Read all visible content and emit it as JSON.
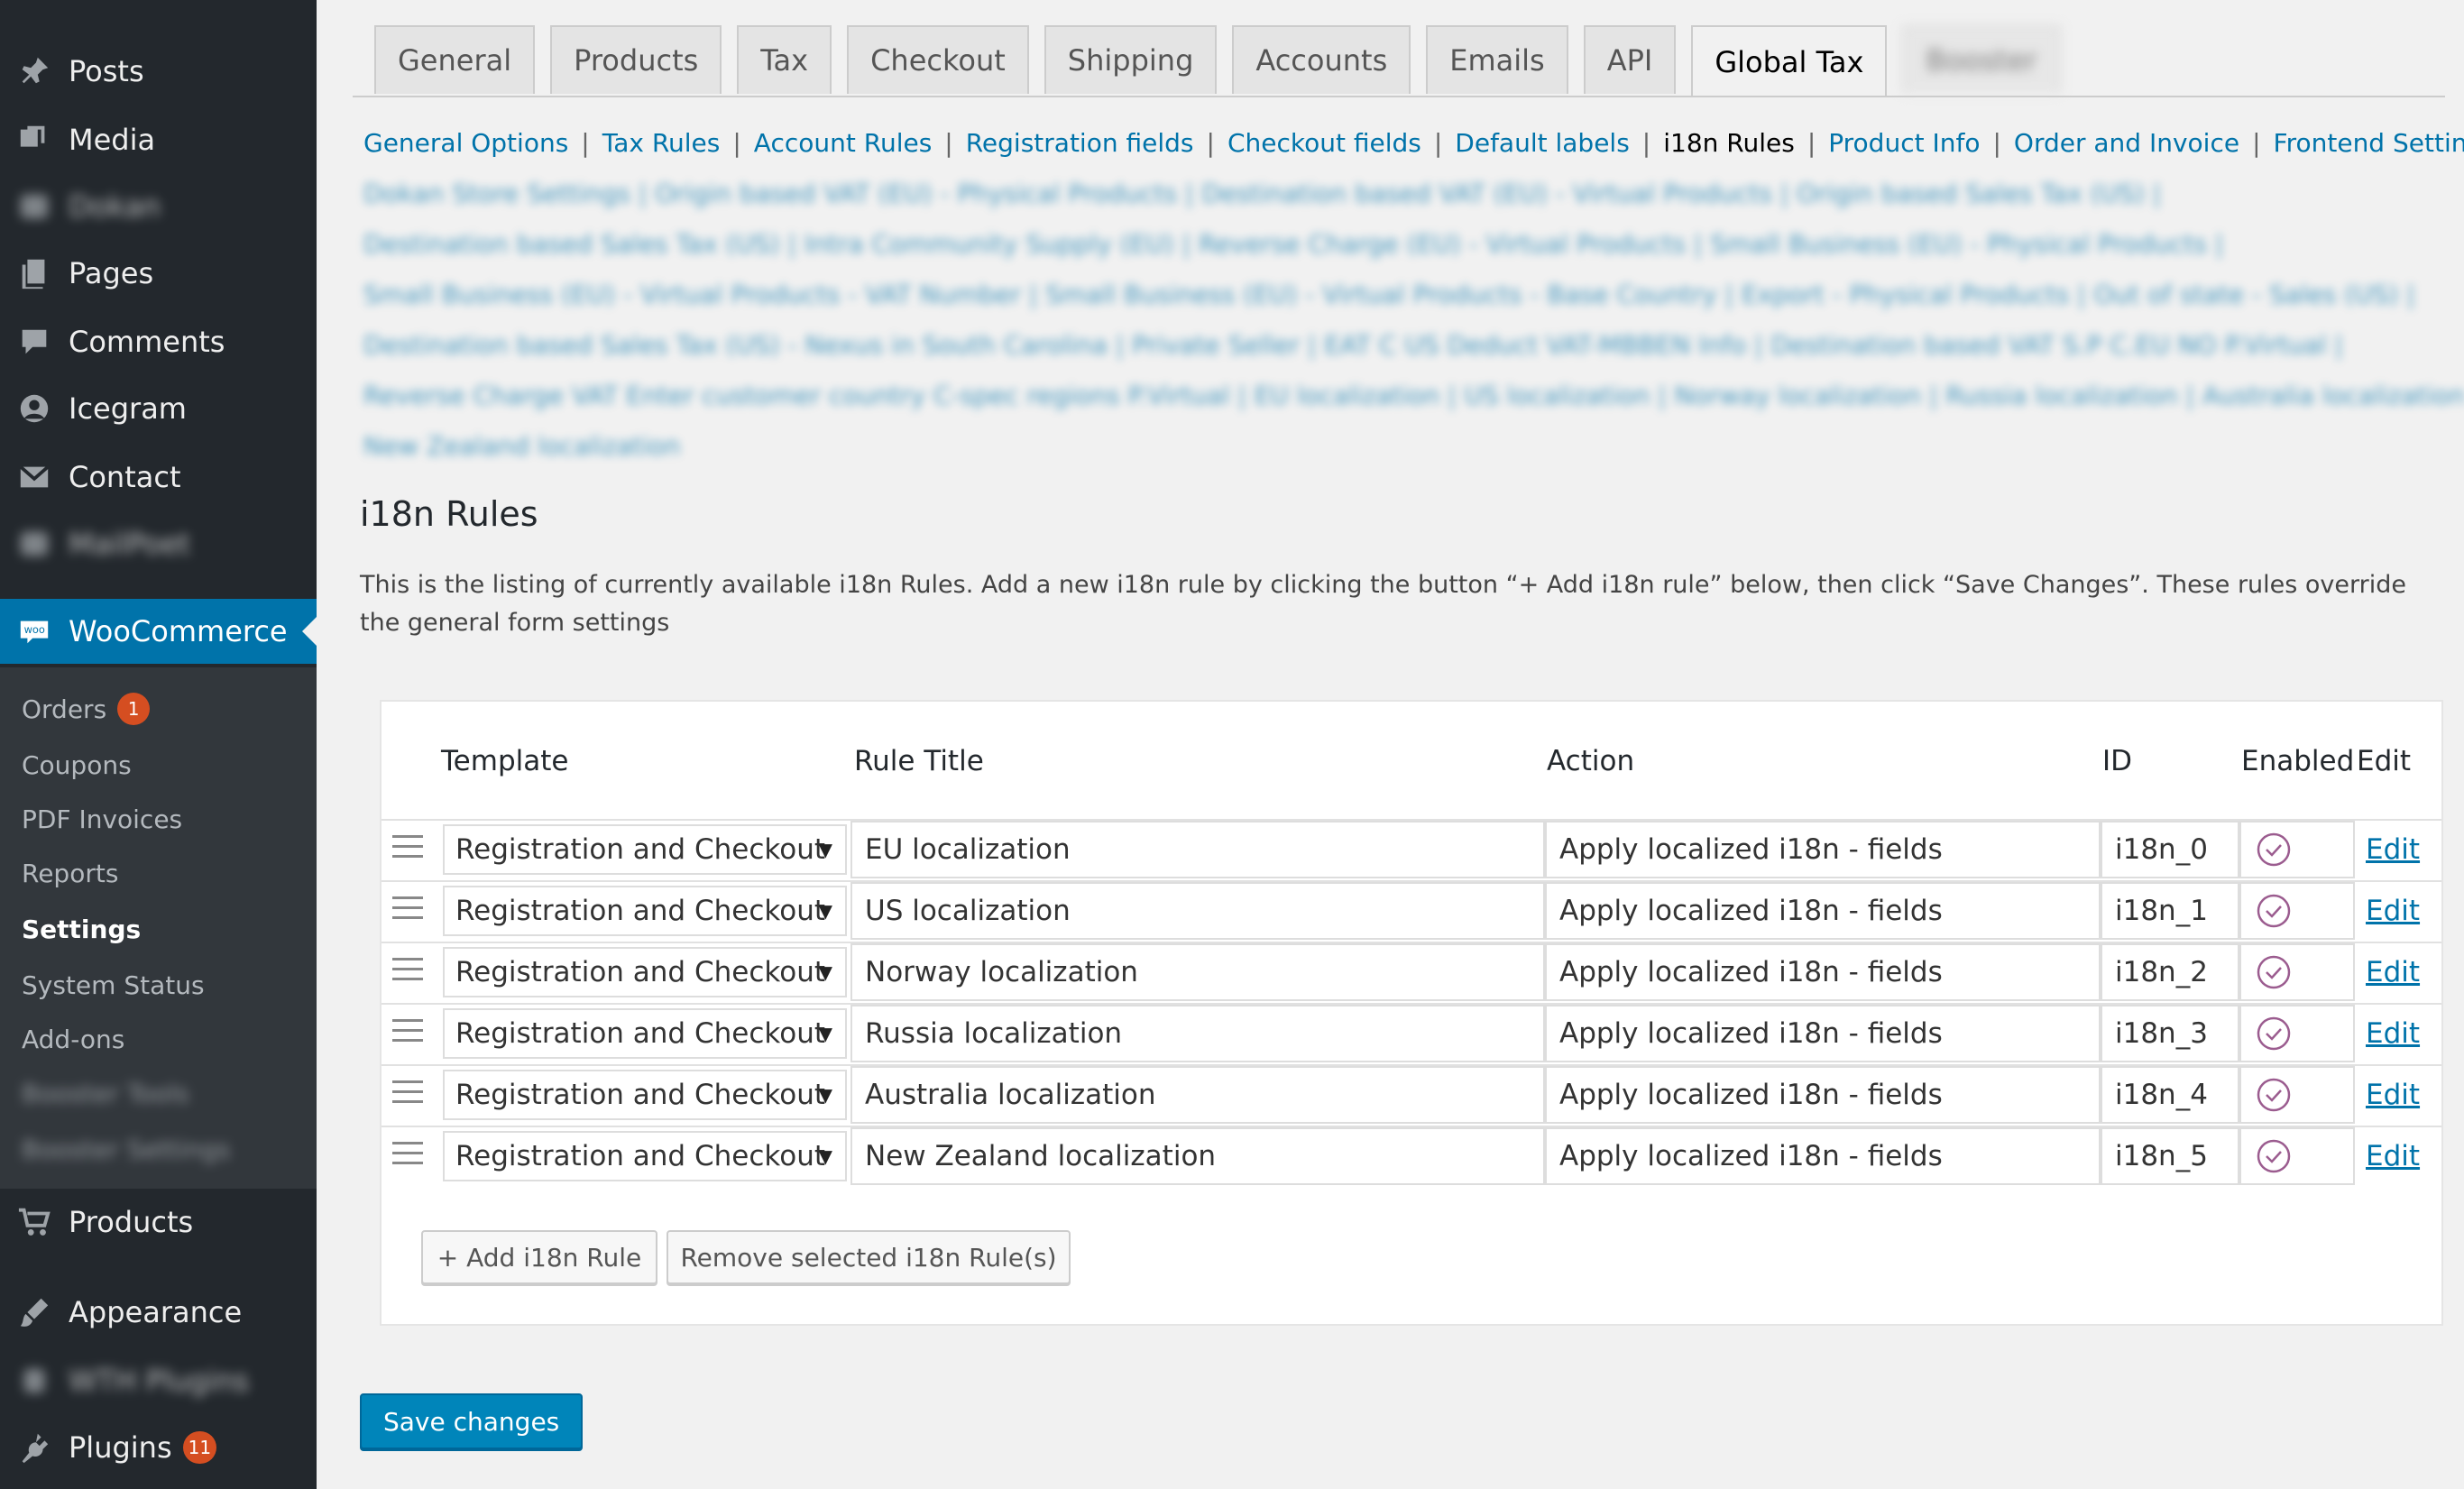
{
  "sidebar": {
    "menu": [
      {
        "label": "Posts",
        "icon": "pin-icon"
      },
      {
        "label": "Media",
        "icon": "media-icon"
      },
      {
        "label": "Dokan",
        "icon": "dokan-icon"
      },
      {
        "label": "Pages",
        "icon": "pages-icon"
      },
      {
        "label": "Comments",
        "icon": "comments-icon"
      },
      {
        "label": "Icegram",
        "icon": "icegram-icon"
      },
      {
        "label": "Contact",
        "icon": "envelope-icon"
      },
      {
        "label": "MailPoet",
        "icon": "mailpoet-icon"
      }
    ],
    "woocommerce": {
      "label": "WooCommerce",
      "icon": "woo-icon"
    },
    "submenu": {
      "orders": {
        "label": "Orders",
        "badge": "1"
      },
      "coupons": "Coupons",
      "pdf_invoices": "PDF Invoices",
      "reports": "Reports",
      "settings": "Settings",
      "system_status": "System Status",
      "addons": "Add-ons",
      "booster_tools": "Booster Tools",
      "booster_settings": "Booster Settings"
    },
    "products": {
      "label": "Products",
      "icon": "cart-icon"
    },
    "appearance": {
      "label": "Appearance",
      "icon": "brush-icon"
    },
    "wpplugins": {
      "label": "WTH Plugins",
      "icon": "plugin-icon"
    },
    "plugins": {
      "label": "Plugins",
      "badge": "11",
      "icon": "plugin-icon"
    }
  },
  "tabs": [
    "General",
    "Products",
    "Tax",
    "Checkout",
    "Shipping",
    "Accounts",
    "Emails",
    "API",
    "Global Tax",
    "Booster"
  ],
  "sublinks": {
    "line1": [
      "General Options",
      "Tax Rules",
      "Account Rules",
      "Registration fields",
      "Checkout fields",
      "Default labels",
      "i18n Rules",
      "Product Info",
      "Order and Invoice",
      "Frontend Settings"
    ],
    "line2": "Dokan Store Settings | Origin based VAT (EU) - Physical Products | Destination based VAT (EU) - Virtual Products | Origin based Sales Tax (US) |",
    "line3": "Destination based Sales Tax (US) | Intra Community Supply (EU) | Reverse Charge (EU) - Virtual Products | Small Business (EU) - Physical Products |",
    "line4": "Small Business (EU) - Virtual Products - VAT Number | Small Business (EU) - Virtual Products - Base Country | Export - Physical Products | Out of state - Sales (US) |",
    "line5": "Destination based Sales Tax (US) - Nexus in South Carolina | Private Seller | EAT C US Deduct VAT-MBBEN Info | Destination based VAT S.P C.EU NO P.Virtual |",
    "line6": "Reverse Charge VAT Enter customer country C-spec regions P.Virtual | EU localization | US localization | Norway localization | Russia localization | Australia localization |",
    "line7": "New Zealand localization"
  },
  "section": {
    "title": "i18n Rules",
    "description": "This is the listing of currently available i18n Rules. Add a new i18n rule by clicking the button “+ Add i18n rule” below, then click “Save Changes”. These rules override the general form settings"
  },
  "table": {
    "headers": {
      "template": "Template",
      "title": "Rule Title",
      "action": "Action",
      "id": "ID",
      "enabled": "Enabled",
      "edit": "Edit"
    },
    "rows": [
      {
        "template": "Registration and Checkout",
        "title": "EU localization",
        "action": "Apply localized i18n - fields",
        "id": "i18n_0",
        "edit": "Edit"
      },
      {
        "template": "Registration and Checkout",
        "title": "US localization",
        "action": "Apply localized i18n - fields",
        "id": "i18n_1",
        "edit": "Edit"
      },
      {
        "template": "Registration and Checkout",
        "title": "Norway localization",
        "action": "Apply localized i18n - fields",
        "id": "i18n_2",
        "edit": "Edit"
      },
      {
        "template": "Registration and Checkout",
        "title": "Russia localization",
        "action": "Apply localized i18n - fields",
        "id": "i18n_3",
        "edit": "Edit"
      },
      {
        "template": "Registration and Checkout",
        "title": "Australia localization",
        "action": "Apply localized i18n - fields",
        "id": "i18n_4",
        "edit": "Edit"
      },
      {
        "template": "Registration and Checkout",
        "title": "New Zealand localization",
        "action": "Apply localized i18n - fields",
        "id": "i18n_5",
        "edit": "Edit"
      }
    ],
    "add_button": "+ Add i18n Rule",
    "remove_button": "Remove selected i18n Rule(s)"
  },
  "save_button": "Save changes",
  "colors": {
    "accent": "#0073aa",
    "sidebar": "#23282d",
    "submenu": "#32373c",
    "badge": "#d54e21",
    "check": "#9b5c8f"
  }
}
